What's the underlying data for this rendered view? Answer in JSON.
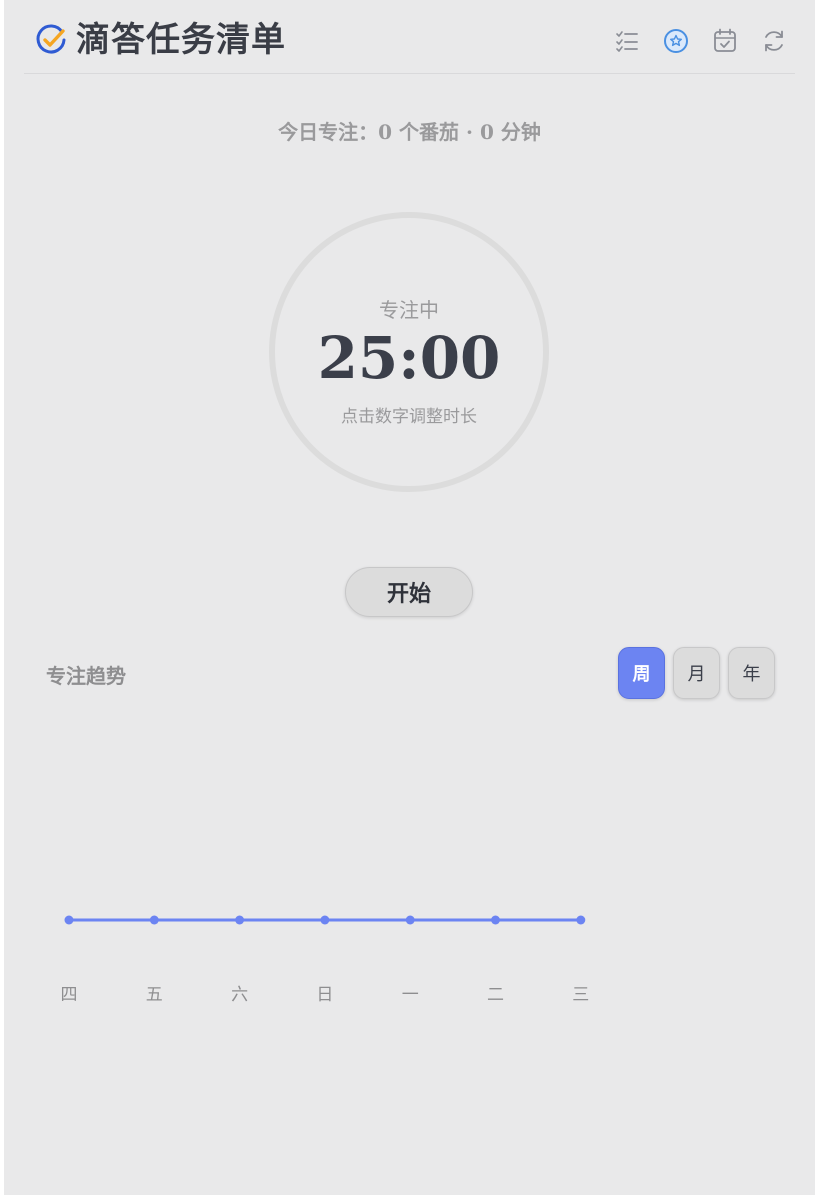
{
  "app": {
    "title": "滴答任务清单"
  },
  "toolbar": {
    "items": [
      {
        "icon": "task-list-icon"
      },
      {
        "icon": "focus-pomodoro-icon",
        "active": true
      },
      {
        "icon": "calendar-check-icon"
      },
      {
        "icon": "sync-icon"
      }
    ]
  },
  "today": {
    "label": "今日专注：",
    "summary": "0 个番茄 · 0 分钟"
  },
  "timer": {
    "state": "专注中",
    "time": "25:00",
    "hint": "点击数字调整时长"
  },
  "start_button": {
    "label": "开始"
  },
  "trend": {
    "title": "专注趋势",
    "ranges": [
      {
        "label": "周",
        "active": true
      },
      {
        "label": "月",
        "active": false
      },
      {
        "label": "年",
        "active": false
      }
    ]
  },
  "colors": {
    "accent": "#6c84f2",
    "brand_blue": "#2f5bd3",
    "brand_orange": "#f5a623",
    "background": "#e9e9ea"
  },
  "chart_data": {
    "type": "line",
    "categories": [
      "四",
      "五",
      "六",
      "日",
      "一",
      "二",
      "三"
    ],
    "series": [
      {
        "values": [
          0,
          0,
          0,
          0,
          0,
          0,
          0
        ]
      }
    ],
    "grid": false,
    "color": "#6c84f2"
  }
}
